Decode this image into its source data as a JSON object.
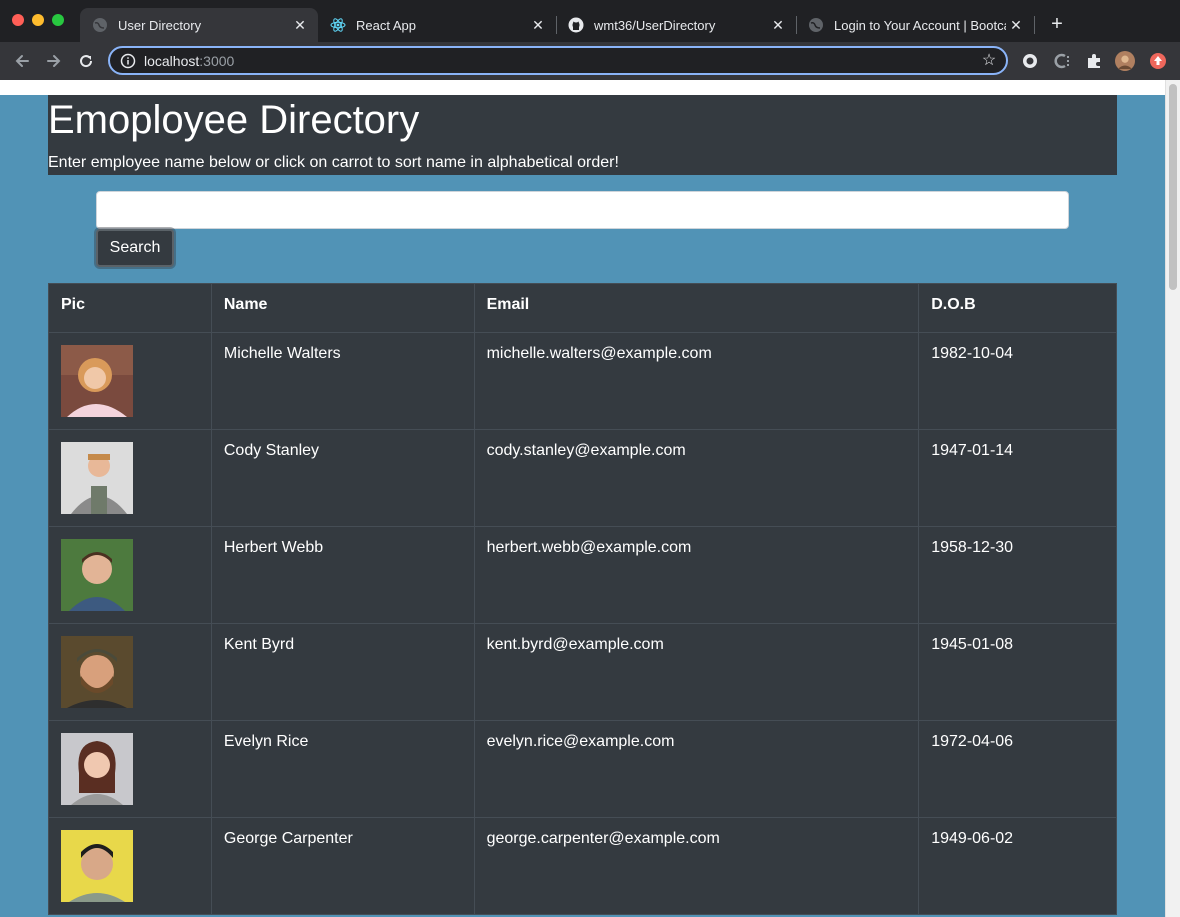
{
  "browser": {
    "tabs": [
      {
        "title": "User Directory",
        "active": true
      },
      {
        "title": "React App",
        "active": false
      },
      {
        "title": "wmt36/UserDirectory",
        "active": false
      },
      {
        "title": "Login to Your Account | Bootca",
        "active": false
      }
    ],
    "url_host": "localhost",
    "url_port": ":3000"
  },
  "page": {
    "heading": "Emoployee Directory",
    "subheading": "Enter employee name below or click on carrot to sort name in alphabetical order!",
    "search": {
      "button_label": "Search",
      "value": "",
      "placeholder": ""
    },
    "table": {
      "headers": [
        "Pic",
        "Name",
        "Email",
        "D.O.B"
      ],
      "rows": [
        {
          "name": "Michelle Walters",
          "email": "michelle.walters@example.com",
          "dob": "1982-10-04"
        },
        {
          "name": "Cody Stanley",
          "email": "cody.stanley@example.com",
          "dob": "1947-01-14"
        },
        {
          "name": "Herbert Webb",
          "email": "herbert.webb@example.com",
          "dob": "1958-12-30"
        },
        {
          "name": "Kent Byrd",
          "email": "kent.byrd@example.com",
          "dob": "1945-01-08"
        },
        {
          "name": "Evelyn Rice",
          "email": "evelyn.rice@example.com",
          "dob": "1972-04-06"
        },
        {
          "name": "George Carpenter",
          "email": "george.carpenter@example.com",
          "dob": "1949-06-02"
        }
      ]
    }
  },
  "colors": {
    "page_background": "#5193b6",
    "panel": "#343a40",
    "browser_chrome": "#202124"
  }
}
